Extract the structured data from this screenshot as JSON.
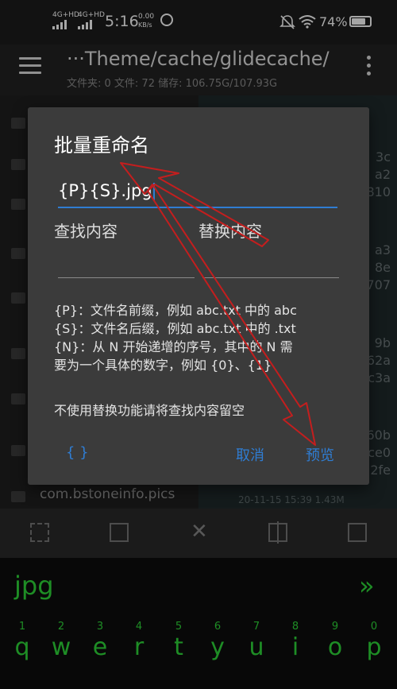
{
  "status_bar": {
    "sim1": "4G+HD",
    "sim2": "4G+HD",
    "time": "5:16",
    "speed_value": "0.00",
    "speed_unit": "KB/s",
    "battery": "74%"
  },
  "topbar": {
    "path": "···Theme/cache/glidecache/",
    "info": "文件夹: 0  文件: 72  储存: 106.75G/107.93G"
  },
  "list": {
    "hashes": [
      "3c",
      "a2",
      "810",
      "a3",
      "8e",
      "707",
      "9b",
      "62a",
      "c3a",
      "60b",
      "ce0",
      "2fe"
    ],
    "bottom_item": "com.bstoneinfo.pics",
    "bottom_meta": "20-11-15 15:39  1.43M"
  },
  "dialog": {
    "title": "批量重命名",
    "input_value": "{P}{S}.jpg",
    "find_label": "查找内容",
    "replace_label": "替换内容",
    "help": [
      "{P}：文件名前缀，例如 abc.txt 中的 abc",
      "{S}：文件名后缀，例如 abc.txt 中的 .txt",
      "{N}：从 N 开始递增的序号，其中的 N 需",
      "要为一个具体的数字，例如 {0}、{1}"
    ],
    "note": "不使用替换功能请将查找内容留空",
    "braces_button": "{ }",
    "cancel_button": "取消",
    "preview_button": "预览"
  },
  "keyboard": {
    "suggestion": "jpg",
    "suggest_arrow": "»",
    "keys": [
      {
        "num": "1",
        "ch": "q"
      },
      {
        "num": "2",
        "ch": "w"
      },
      {
        "num": "3",
        "ch": "e"
      },
      {
        "num": "4",
        "ch": "r"
      },
      {
        "num": "5",
        "ch": "t"
      },
      {
        "num": "6",
        "ch": "y"
      },
      {
        "num": "7",
        "ch": "u"
      },
      {
        "num": "8",
        "ch": "i"
      },
      {
        "num": "9",
        "ch": "o"
      },
      {
        "num": "0",
        "ch": "p"
      }
    ]
  },
  "colors": {
    "accent": "#2f7dd3",
    "keyboard_text": "#2fd93a",
    "annotation": "#c41e1e"
  }
}
